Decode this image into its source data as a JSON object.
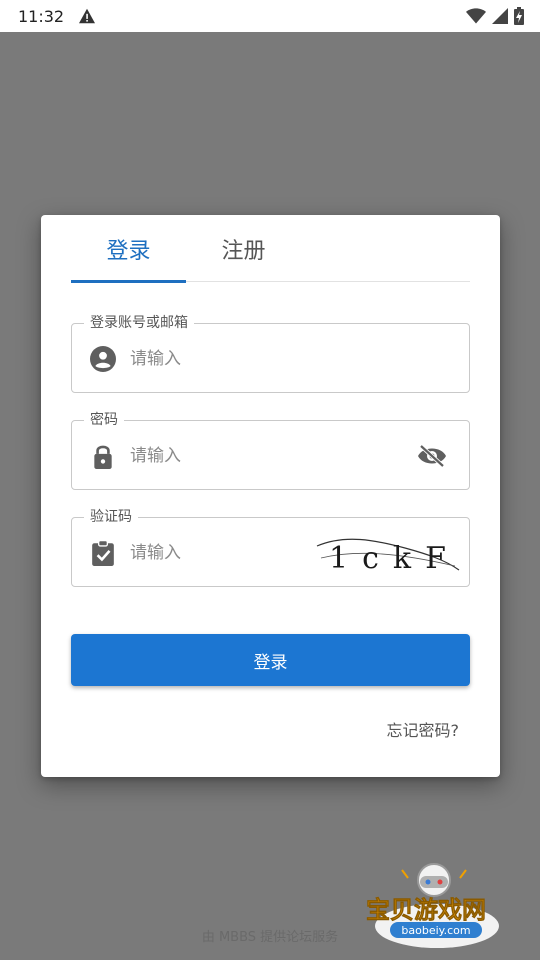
{
  "status_bar": {
    "time": "11:32",
    "icons": [
      "warning-icon",
      "wifi-icon",
      "signal-icon",
      "battery-charging-icon"
    ]
  },
  "tabs": [
    {
      "label": "登录",
      "active": true
    },
    {
      "label": "注册",
      "active": false
    }
  ],
  "form": {
    "account": {
      "label": "登录账号或邮箱",
      "placeholder": "请输入",
      "value": "",
      "icon": "account-circle-icon"
    },
    "password": {
      "label": "密码",
      "placeholder": "请输入",
      "value": "",
      "icon": "lock-icon",
      "toggle_icon": "eye-off-icon"
    },
    "captcha": {
      "label": "验证码",
      "placeholder": "请输入",
      "value": "",
      "icon": "clipboard-check-icon",
      "image_text": "1ckF"
    }
  },
  "login_button": {
    "label": "登录"
  },
  "forgot_password": {
    "label": "忘记密码?"
  },
  "footer": {
    "text": "由 MBBS 提供论坛服务"
  },
  "watermark": {
    "title": "宝贝游戏网",
    "url": "baobeiy.com"
  },
  "colors": {
    "primary": "#1c76d2",
    "tab_active": "#1e6fc0",
    "overlay": "#7a7a7a",
    "icon_gray": "#5f5f5f"
  }
}
